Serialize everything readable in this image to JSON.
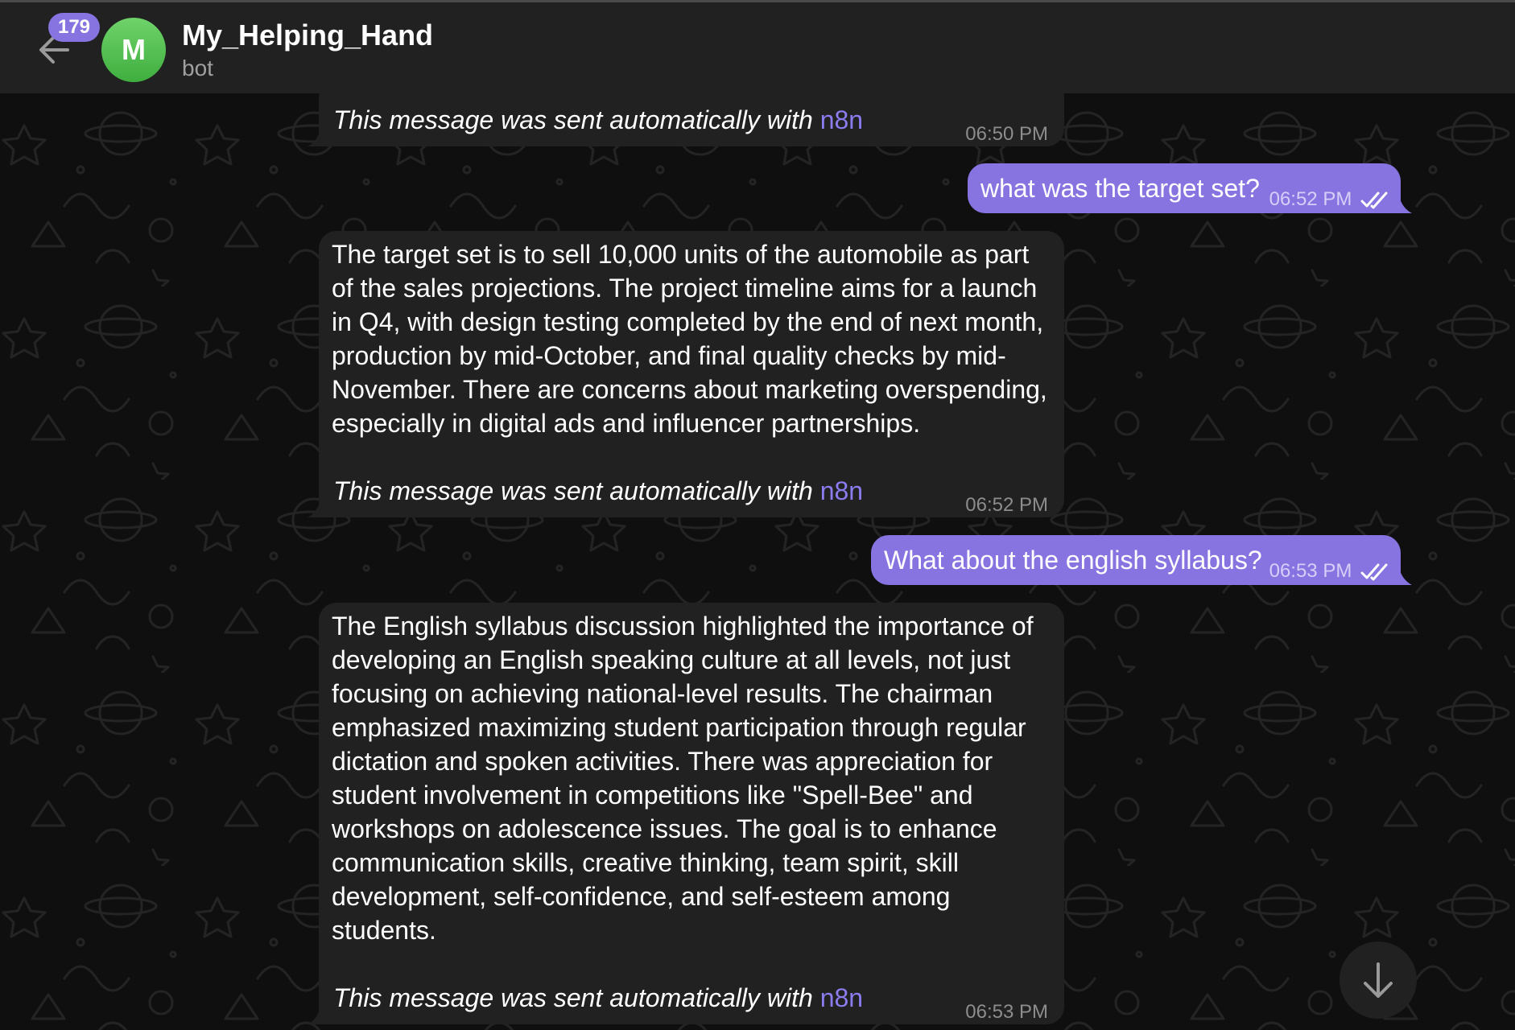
{
  "header": {
    "unread_count": "179",
    "avatar_letter": "M",
    "title": "My_Helping_Hand",
    "subtitle": "bot"
  },
  "messages": [
    {
      "id": "m1",
      "direction": "incoming",
      "text": "",
      "footer_prefix": "This message was sent automatically with ",
      "footer_link": "n8n",
      "time": "06:50 PM"
    },
    {
      "id": "m2",
      "direction": "outgoing",
      "text": "what was the target set?",
      "time": "06:52 PM",
      "status": "read"
    },
    {
      "id": "m3",
      "direction": "incoming",
      "text": "The target set is to sell 10,000 units of the automobile as part of the sales projections. The project timeline aims for a launch in Q4, with design testing completed by the end of next month, production by mid-October, and final quality checks by mid-November. There are concerns about marketing overspending, especially in digital ads and influencer partnerships.",
      "footer_prefix": "This message was sent automatically with ",
      "footer_link": "n8n",
      "time": "06:52 PM"
    },
    {
      "id": "m4",
      "direction": "outgoing",
      "text": "What about the english syllabus?",
      "time": "06:53 PM",
      "status": "read"
    },
    {
      "id": "m5",
      "direction": "incoming",
      "text": "The English syllabus discussion highlighted the importance of developing an English speaking culture at all levels, not just focusing on achieving national-level results. The chairman emphasized maximizing student participation through regular dictation and spoken activities. There was appreciation for student involvement in competitions like \"Spell-Bee\" and workshops on adolescence issues. The goal is to enhance communication skills, creative thinking, team spirit, skill development, self-confidence, and self-esteem among students.",
      "footer_prefix": "This message was sent automatically with ",
      "footer_link": "n8n",
      "time": "06:53 PM"
    }
  ],
  "icons": {
    "back": "arrow-left-icon",
    "read_status": "double-check-icon",
    "scroll_down": "arrow-down-icon"
  },
  "colors": {
    "accent": "#8774e1",
    "link": "#8b7cf0",
    "incoming_bubble": "#212121",
    "header_bg": "#212121",
    "avatar": "#4cbb4a"
  }
}
